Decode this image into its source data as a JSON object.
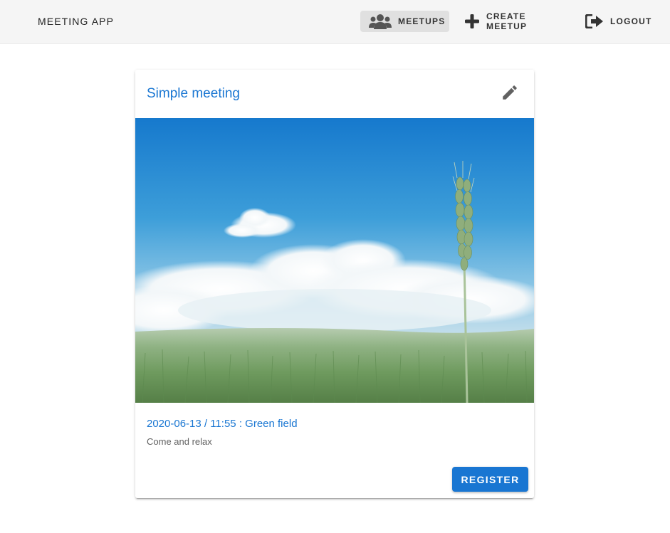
{
  "toolbar": {
    "title": "MEETING APP",
    "nav": [
      {
        "label": "MEETUPS",
        "icon": "users-icon",
        "active": true
      },
      {
        "label": "CREATE MEETUP",
        "icon": "plus-icon",
        "active": false
      },
      {
        "label": "LOGOUT",
        "icon": "sign-out-icon",
        "active": false
      }
    ]
  },
  "meetup": {
    "title": "Simple meeting",
    "image": "wheat-field-sky-photo",
    "meta": "2020-06-13 / 11:55 : Green field",
    "description": "Come and relax",
    "register_label": "REGISTER"
  },
  "colors": {
    "primary": "#1976d2",
    "toolbar_bg": "#f5f5f5",
    "active_nav_bg": "#e0e0e0"
  }
}
